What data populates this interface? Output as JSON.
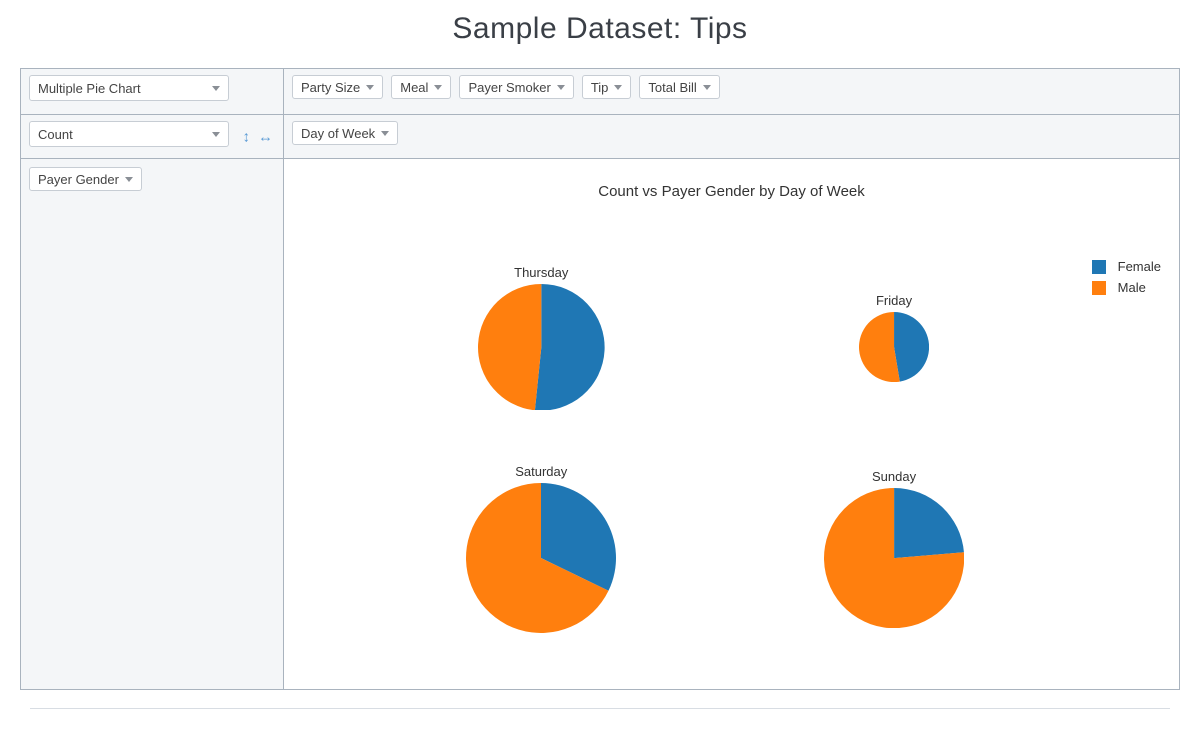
{
  "title": "Sample Dataset: Tips",
  "controls": {
    "renderer": "Multiple Pie Chart",
    "aggregator": "Count",
    "unused_fields": [
      "Party Size",
      "Meal",
      "Payer Smoker",
      "Tip",
      "Total Bill"
    ],
    "col_fields": [
      "Day of Week"
    ],
    "row_fields": [
      "Payer Gender"
    ]
  },
  "chart_data": {
    "type": "pie",
    "title": "Count vs Payer Gender by Day of Week",
    "legend_position": "right",
    "series_colors": {
      "Female": "#1f77b4",
      "Male": "#ff7f0e"
    },
    "legend": [
      "Female",
      "Male"
    ],
    "pies": [
      {
        "name": "Thursday",
        "values": {
          "Female": 32,
          "Male": 30
        },
        "total": 62
      },
      {
        "name": "Friday",
        "values": {
          "Female": 9,
          "Male": 10
        },
        "total": 19
      },
      {
        "name": "Saturday",
        "values": {
          "Female": 28,
          "Male": 59
        },
        "total": 87
      },
      {
        "name": "Sunday",
        "values": {
          "Female": 18,
          "Male": 58
        },
        "total": 76
      }
    ],
    "grid": {
      "rows": 2,
      "cols": 2
    }
  }
}
